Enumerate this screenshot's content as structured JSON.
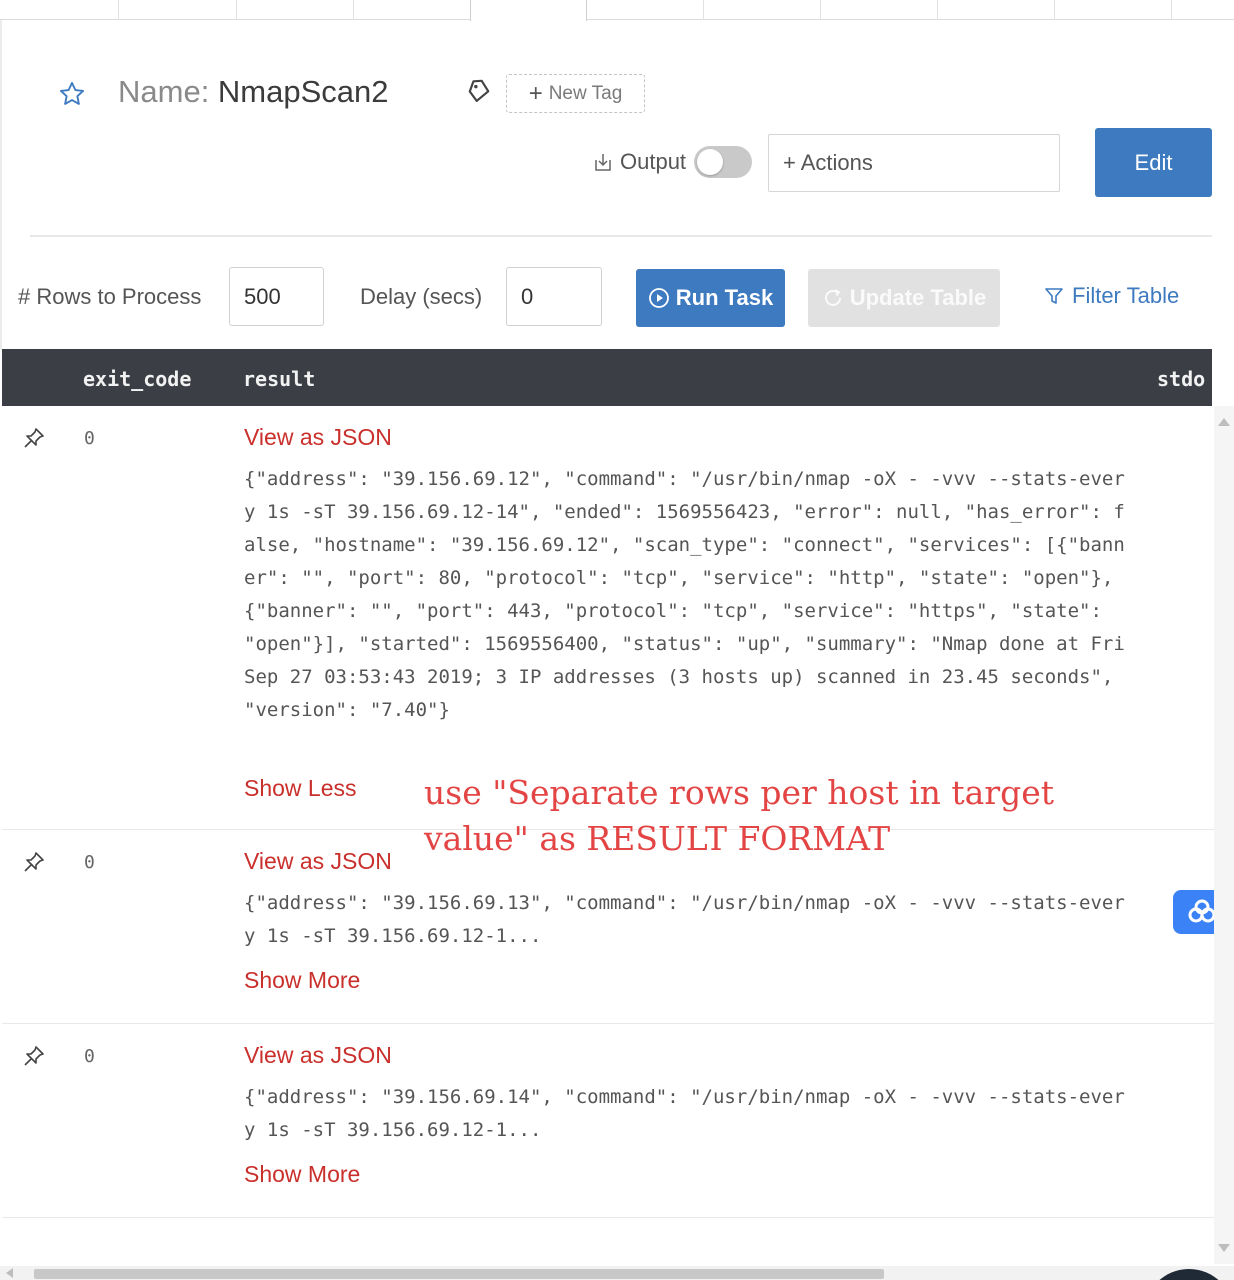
{
  "header": {
    "name_prefix": "Name: ",
    "name_value": "NmapScan2",
    "new_tag_label": "New Tag"
  },
  "toolbar": {
    "output_label": "Output",
    "output_enabled": false,
    "actions_label": "+ Actions",
    "edit_label": "Edit"
  },
  "controls": {
    "rows_label": "# Rows to Process",
    "rows_value": "500",
    "delay_label": "Delay (secs)",
    "delay_value": "0",
    "run_label": "Run Task",
    "update_label": "Update Table",
    "filter_label": "Filter Table"
  },
  "table": {
    "columns": [
      "exit_code",
      "result",
      "stdo"
    ],
    "rows": [
      {
        "exit_code": "0",
        "view_json": "View as JSON",
        "result": "{\"address\": \"39.156.69.12\", \"command\": \"/usr/bin/nmap -oX - -vvv --stats-every 1s -sT 39.156.69.12-14\", \"ended\": 1569556423, \"error\": null, \"has_error\": false, \"hostname\": \"39.156.69.12\", \"scan_type\": \"connect\", \"services\": [{\"banner\": \"\", \"port\": 80, \"protocol\": \"tcp\", \"service\": \"http\", \"state\": \"open\"}, {\"banner\": \"\", \"port\": 443, \"protocol\": \"tcp\", \"service\": \"https\", \"state\": \"open\"}], \"started\": 1569556400, \"status\": \"up\", \"summary\": \"Nmap done at Fri Sep 27 03:53:43 2019; 3 IP addresses (3 hosts up) scanned in 23.45 seconds\", \"version\": \"7.40\"}",
        "toggle": "Show Less"
      },
      {
        "exit_code": "0",
        "view_json": "View as JSON",
        "result": "{\"address\": \"39.156.69.13\", \"command\": \"/usr/bin/nmap -oX - -vvv --stats-every 1s -sT 39.156.69.12-1...",
        "toggle": "Show More"
      },
      {
        "exit_code": "0",
        "view_json": "View as JSON",
        "result": "{\"address\": \"39.156.69.14\", \"command\": \"/usr/bin/nmap -oX - -vvv --stats-every 1s -sT 39.156.69.12-1...",
        "toggle": "Show More"
      }
    ]
  },
  "annotation": "use \"Separate rows per host in target value\" as RESULT FORMAT",
  "colors": {
    "primary": "#3d7ac0",
    "link_red": "#c9302c",
    "annotation_red": "#e34545",
    "table_header": "#3b3f45"
  },
  "icons": {
    "favorite": "star-icon",
    "tag": "tag-icon",
    "output": "download-icon",
    "run": "play-circle-icon",
    "update": "refresh-icon",
    "filter": "filter-icon",
    "pin": "pin-icon",
    "widget": "cloud-sync-icon"
  }
}
